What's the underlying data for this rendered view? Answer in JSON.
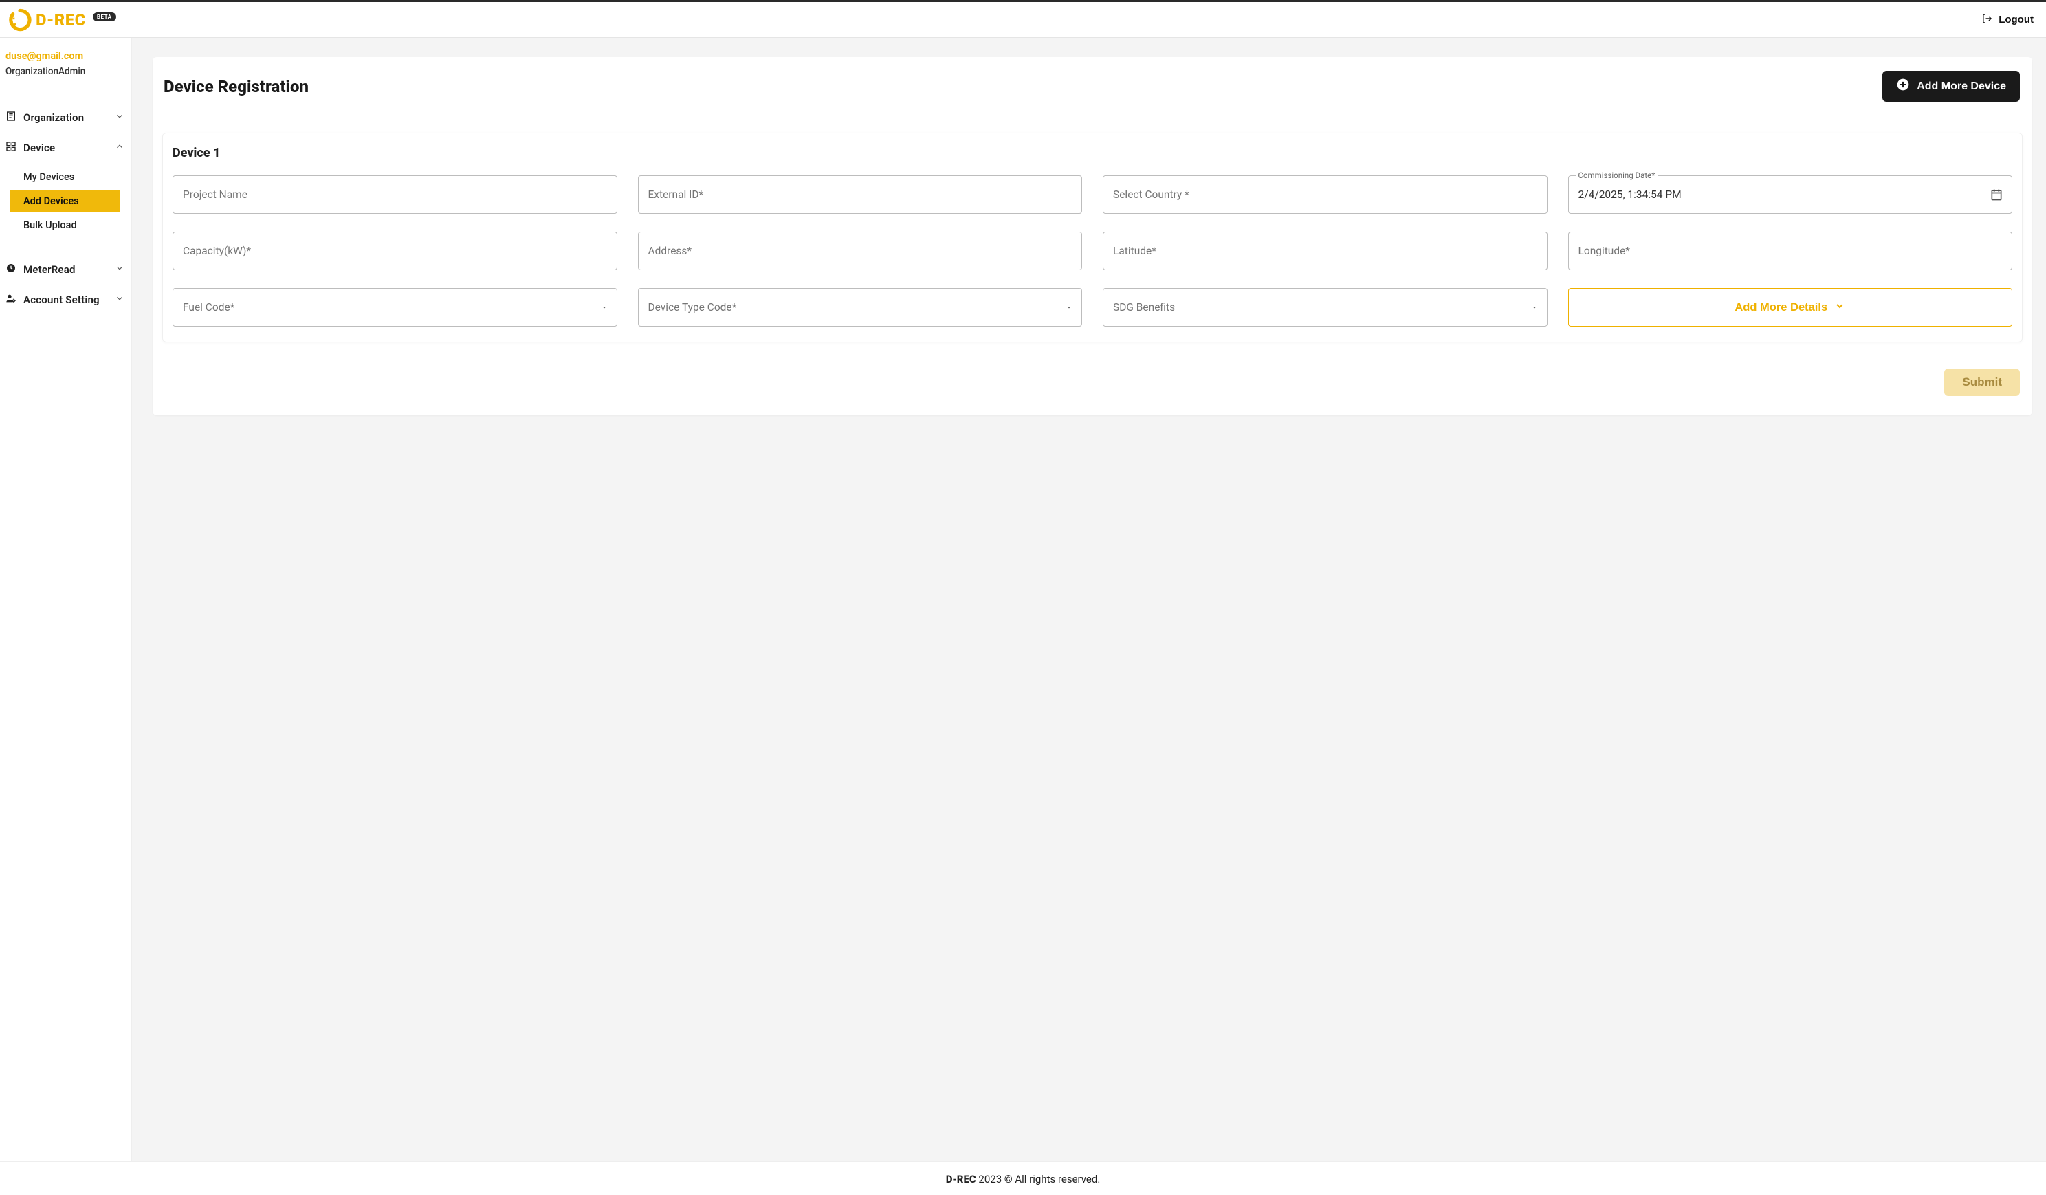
{
  "brand": {
    "name": "D-REC",
    "badge": "BETA"
  },
  "header": {
    "logout": "Logout"
  },
  "user": {
    "email": "duse@gmail.com",
    "role": "OrganizationAdmin"
  },
  "sidebar": {
    "organization": "Organization",
    "device": "Device",
    "device_items": {
      "my_devices": "My Devices",
      "add_devices": "Add Devices",
      "bulk_upload": "Bulk Upload"
    },
    "meterread": "MeterRead",
    "account_setting": "Account Setting"
  },
  "page": {
    "title": "Device Registration",
    "add_more_device": "Add More Device",
    "device_section_title": "Device 1",
    "add_more_details": "Add More Details",
    "submit": "Submit"
  },
  "fields": {
    "project_name": {
      "placeholder": "Project Name",
      "value": ""
    },
    "external_id": {
      "placeholder": "External ID*",
      "value": ""
    },
    "country": {
      "placeholder": "Select Country *",
      "value": ""
    },
    "commissioning_date": {
      "label": "Commissioning Date*",
      "value": "2/4/2025, 1:34:54 PM"
    },
    "capacity": {
      "placeholder": "Capacity(kW)*",
      "value": ""
    },
    "address": {
      "placeholder": "Address*",
      "value": ""
    },
    "latitude": {
      "placeholder": "Latitude*",
      "value": ""
    },
    "longitude": {
      "placeholder": "Longitude*",
      "value": ""
    },
    "fuel_code": {
      "placeholder": "Fuel Code*",
      "value": ""
    },
    "device_type_code": {
      "placeholder": "Device Type Code*",
      "value": ""
    },
    "sdg_benefits": {
      "placeholder": "SDG Benefits",
      "value": ""
    }
  },
  "footer": {
    "brand": "D-REC",
    "rest": " 2023 © All rights reserved."
  }
}
